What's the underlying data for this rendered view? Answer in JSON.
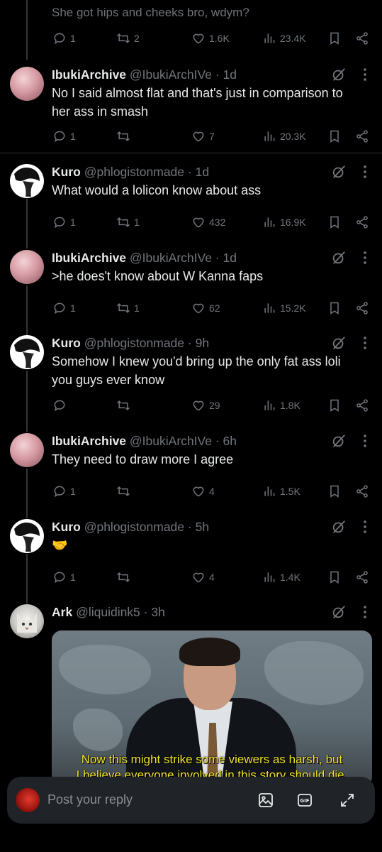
{
  "top": {
    "partial_text": "She got hips and cheeks bro, wdym?",
    "replies": "1",
    "reposts": "2",
    "likes": "1.6K",
    "views": "23.4K"
  },
  "tweets": [
    {
      "name": "IbukiArchive",
      "handle": "@IbukiArchIVe",
      "time": "1d",
      "text": "No I said almost flat and that's just in comparison to her ass in smash",
      "replies": "1",
      "reposts": "",
      "likes": "7",
      "views": "20.3K"
    },
    {
      "name": "Kuro",
      "handle": "@phlogistonmade",
      "time": "1d",
      "text": "What would a lolicon know about ass",
      "replies": "1",
      "reposts": "1",
      "likes": "432",
      "views": "16.9K"
    },
    {
      "name": "IbukiArchive",
      "handle": "@IbukiArchIVe",
      "time": "1d",
      "text": ">he does't know about W Kanna faps",
      "replies": "1",
      "reposts": "1",
      "likes": "62",
      "views": "15.2K"
    },
    {
      "name": "Kuro",
      "handle": "@phlogistonmade",
      "time": "9h",
      "text": "Somehow I knew you'd bring up the only fat ass loli you guys ever know",
      "replies": "",
      "reposts": "",
      "likes": "29",
      "views": "1.8K"
    },
    {
      "name": "IbukiArchive",
      "handle": "@IbukiArchIVe",
      "time": "6h",
      "text": "They need to draw more I agree",
      "replies": "1",
      "reposts": "",
      "likes": "4",
      "views": "1.5K"
    },
    {
      "name": "Kuro",
      "handle": "@phlogistonmade",
      "time": "5h",
      "text": "🤝",
      "replies": "1",
      "reposts": "",
      "likes": "4",
      "views": "1.4K"
    },
    {
      "name": "Ark",
      "handle": "@liquidink5",
      "time": "3h",
      "text": ""
    }
  ],
  "media": {
    "subtitle_line1": "Now this might strike some viewers as harsh, but",
    "subtitle_line2": "I believe everyone involved in this story should die."
  },
  "reply_bar": {
    "placeholder": "Post your reply"
  },
  "colors": {
    "background": "#000000",
    "text": "#e7e9ea",
    "muted": "#71767b",
    "subtitle": "#f2e32c"
  },
  "icons": [
    "reply-icon",
    "repost-icon",
    "like-icon",
    "views-icon",
    "bookmark-icon",
    "share-icon",
    "grok-icon",
    "more-icon",
    "image-icon",
    "gif-icon",
    "expand-icon"
  ]
}
